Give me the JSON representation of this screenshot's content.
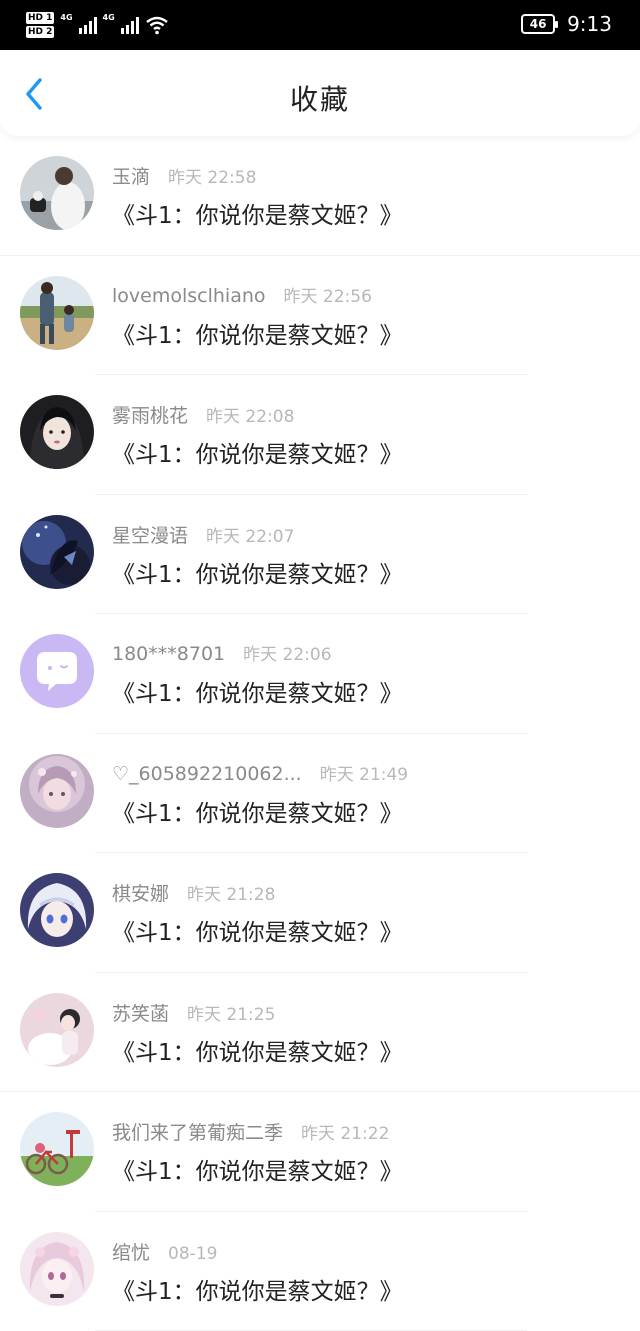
{
  "status_bar": {
    "sim1": "HD 1",
    "sim2": "HD 2",
    "net1": "4G",
    "net2": "4G",
    "battery": "46",
    "time": "9:13"
  },
  "header": {
    "back_icon": "chevron-left-icon",
    "title": "收藏",
    "accent_color": "#2196f3"
  },
  "items": [
    {
      "nickname": "玉滴",
      "time": "昨天 22:58",
      "title": "《斗1：你说你是蔡文姬？》",
      "avatar_icon": "user-photo-avatar"
    },
    {
      "nickname": "lovemolsclhiano",
      "time": "昨天 22:56",
      "title": "《斗1：你说你是蔡文姬？》",
      "avatar_icon": "user-photo-avatar"
    },
    {
      "nickname": "雾雨桃花",
      "time": "昨天 22:08",
      "title": "《斗1：你说你是蔡文姬？》",
      "avatar_icon": "user-photo-avatar"
    },
    {
      "nickname": "星空漫语",
      "time": "昨天 22:07",
      "title": "《斗1：你说你是蔡文姬？》",
      "avatar_icon": "user-photo-avatar"
    },
    {
      "nickname": "180***8701",
      "time": "昨天 22:06",
      "title": "《斗1：你说你是蔡文姬？》",
      "avatar_icon": "default-chat-avatar"
    },
    {
      "nickname": "♡_605892210062...",
      "time": "昨天 21:49",
      "title": "《斗1：你说你是蔡文姬？》",
      "avatar_icon": "user-photo-avatar"
    },
    {
      "nickname": "棋安娜",
      "time": "昨天 21:28",
      "title": "《斗1：你说你是蔡文姬？》",
      "avatar_icon": "user-photo-avatar"
    },
    {
      "nickname": "苏笑菡",
      "time": "昨天 21:25",
      "title": "《斗1：你说你是蔡文姬？》",
      "avatar_icon": "user-photo-avatar"
    },
    {
      "nickname": "我们来了第葡痴二季",
      "time": "昨天 21:22",
      "title": "《斗1：你说你是蔡文姬？》",
      "avatar_icon": "user-photo-avatar"
    },
    {
      "nickname": "绾忧",
      "time": "08-19",
      "title": "《斗1：你说你是蔡文姬？》",
      "avatar_icon": "user-photo-avatar"
    }
  ]
}
